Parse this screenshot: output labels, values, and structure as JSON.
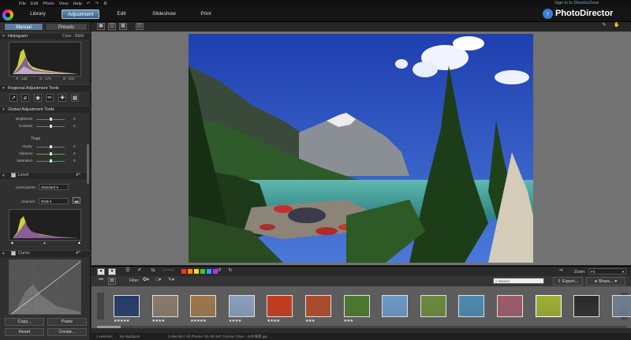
{
  "menu": [
    "File",
    "Edit",
    "Photo",
    "View",
    "Help"
  ],
  "tabs": [
    "Library",
    "Adjustment",
    "Edit",
    "Slideshow",
    "Print"
  ],
  "signin": "Sign in to DirectorZone",
  "brand": "PhotoDirector",
  "left": {
    "tabs": [
      "Manual",
      "Presets"
    ],
    "histogram": {
      "title": "Histogram",
      "mode": "Color : B&W",
      "r": "R : 133",
      "g": "G : 174",
      "b": "B : 225"
    },
    "regional_title": "Regional Adjustment Tools",
    "regional_tools": [
      "↗",
      "⌀",
      "◉",
      "✏",
      "✚",
      "▦"
    ],
    "global_title": "Global Adjustment Tools",
    "brightness": {
      "label": "Brightness",
      "value": "0"
    },
    "contrast": {
      "label": "Contrast",
      "value": "0"
    },
    "tinge_title": "Tinge",
    "clarity": {
      "label": "Clarity",
      "value": "0"
    },
    "vibrance": {
      "label": "Vibrance",
      "value": "0"
    },
    "saturation": {
      "label": "Saturation",
      "value": "0"
    },
    "level": {
      "label": "Level",
      "preset_label": "Level preset:",
      "preset_value": "Standard",
      "channel_label": "Channel:",
      "channel_value": "RGB"
    },
    "curve": {
      "label": "Curve"
    },
    "buttons": {
      "copy": "Copy...",
      "paste": "Paste",
      "reset": "Reset",
      "create": "Create..."
    }
  },
  "filmstrip": {
    "filter_label": "Filter:",
    "search_placeholder": "Search",
    "export": "Export...",
    "share": "Share...",
    "zoom_label": "Zoom:",
    "zoom_value": "Fit",
    "flag_colors": [
      "#e33",
      "#f80",
      "#fd0",
      "#3c3",
      "#39f",
      "#a3f"
    ],
    "thumb_colors": [
      "#233a6a",
      "#8a7a6a",
      "#a0784a",
      "#8aa0c0",
      "#c83a1a",
      "#b04a28",
      "#4a7a2a",
      "#6a9ac8",
      "#6a8a3a",
      "#4a8ab0",
      "#a05a6a",
      "#a0b030",
      "#2a2a2a",
      "#708090"
    ],
    "ratings": [
      "★★★★★",
      "★★★★",
      "★★★★★",
      "★★★★",
      "★★★★",
      "★★★",
      "★★★",
      "",
      "",
      "",
      "",
      "",
      "",
      ""
    ]
  },
  "status": {
    "selected": "1 selected",
    "displayed": "58 displayed",
    "path": "Collection / All Photos / EL 8D MC Canvas Chen - 山中海景.jpg"
  }
}
